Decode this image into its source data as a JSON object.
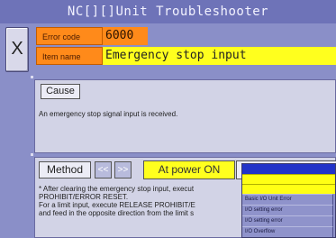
{
  "window": {
    "title": "NC[][]Unit  Troubleshooter",
    "close_label": "X"
  },
  "error": {
    "code_label": "Error code",
    "code_value": "6000",
    "name_label": "Item name",
    "name_value": "Emergency stop input"
  },
  "cause": {
    "tab_label": "Cause",
    "text": "An emergency stop signal input is received."
  },
  "method": {
    "label": "Method",
    "prev_label": "<<",
    "next_label": ">>",
    "power_label": "At power ON",
    "lines": [
      "* After clearing the emergency stop input, execut",
      "PROHIBIT/ERROR RESET.",
      "For a limit input, execute RELEASE PROHIBIT/E",
      "and feed in the opposite direction from the limit s"
    ]
  },
  "dropdown": {
    "items": [
      "Basic I/O Unit Error",
      "I/O setting error",
      "I/O setting error",
      "I/O Overflow"
    ]
  },
  "colors": {
    "background": "#8a8fc8",
    "title_bar": "#6e73b8",
    "label_orange": "#ff8a1a",
    "highlight_yellow": "#ffff1e",
    "panel": "#d2d3e6",
    "dropdown_header": "#2233c8"
  }
}
